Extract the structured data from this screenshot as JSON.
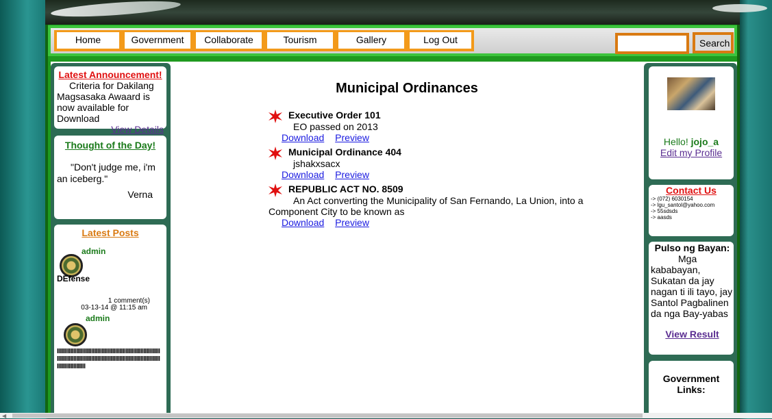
{
  "nav": {
    "items": [
      "Home",
      "Government",
      "Collaborate",
      "Tourism",
      "Gallery",
      "Log Out"
    ],
    "search_placeholder": "",
    "search_label": "Search"
  },
  "announcement": {
    "title": "Latest Announcement!",
    "text": "Criteria for Dakilang Magsasaka Awaard is now available for Download",
    "link": "View Details"
  },
  "thought": {
    "title": "Thought of the Day!",
    "quote": "\"Don't judge me, i'm an iceberg.\"",
    "author": "Verna"
  },
  "latest_posts": {
    "title": "Latest Posts",
    "posts": [
      {
        "author": "admin",
        "text": "DEfense",
        "comments": "1 comment(s)",
        "date": "03-13-14 @ 11:15 am"
      },
      {
        "author": "admin",
        "text": "IIIIIIIIIIIIIIIIIIIIIIIIIIIIIIIIIIIIIIIIIIIIIIIIIIIIIIIIIIIIIIIIIIIIIIIIIIIIIIIIIIIIIIIIIIIIIIIIIIIIIIIIIIIIIIIIIIIIIIIIIIIIIIIIIIIIIIIIIIIIIIIIIIIIIIIIIIIII"
      }
    ]
  },
  "page": {
    "title": "Municipal Ordinances",
    "ordinances": [
      {
        "title": "Executive Order 101",
        "desc": "EO passed on 2013",
        "download": "Download",
        "preview": "Preview"
      },
      {
        "title": "Municipal Ordinance 404",
        "desc": "jshakxsacx",
        "download": "Download",
        "preview": "Preview"
      },
      {
        "title": "REPUBLIC ACT NO. 8509",
        "desc": "An Act converting the Municipality of San Fernando, La Union, into a Component City to be known as",
        "download": "Download",
        "preview": "Preview"
      }
    ]
  },
  "profile": {
    "greeting": "Hello!",
    "username": "jojo_a",
    "edit_link": "Edit my Profile"
  },
  "contact": {
    "title": "Contact Us",
    "lines": [
      "-> (072) 6030154",
      "-> lgu_santol@yahoo.com",
      "-> 55sdsds",
      "-> aasds"
    ]
  },
  "pulso": {
    "title": "Pulso ng Bayan:",
    "text": "Mga kababayan, Sukatan da jay nagan ti ili tayo, jay Santol Pagbalinen da nga Bay-yabas",
    "link": "View Result"
  },
  "gov_links": {
    "title": "Government Links:"
  },
  "colors": {
    "nav_border": "#f39a1a",
    "frame_green": "#1f9a1f",
    "sidebar_dark": "#2e6b54",
    "announcement_red": "#e01010",
    "link_purple": "#5a2d91",
    "link_blue": "#1a1ae0",
    "star_red": "#e01010"
  }
}
